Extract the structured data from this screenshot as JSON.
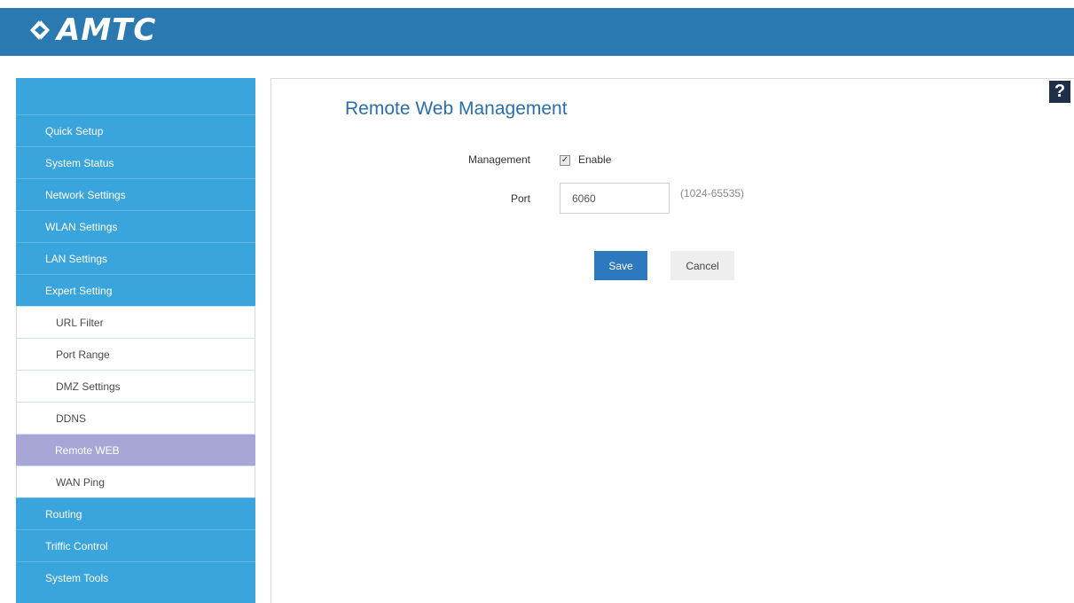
{
  "header": {
    "brand": "AMTC",
    "help_label": "?"
  },
  "sidebar": {
    "items": [
      {
        "label": "Quick Setup",
        "type": "main"
      },
      {
        "label": "System Status",
        "type": "main"
      },
      {
        "label": "Network Settings",
        "type": "main"
      },
      {
        "label": "WLAN Settings",
        "type": "main"
      },
      {
        "label": "LAN Settings",
        "type": "main"
      },
      {
        "label": "Expert Setting",
        "type": "main"
      },
      {
        "label": "URL Filter",
        "type": "sub"
      },
      {
        "label": "Port Range",
        "type": "sub"
      },
      {
        "label": "DMZ Settings",
        "type": "sub"
      },
      {
        "label": "DDNS",
        "type": "sub"
      },
      {
        "label": "Remote WEB",
        "type": "sub",
        "active": true
      },
      {
        "label": "WAN Ping",
        "type": "sub"
      },
      {
        "label": "Routing",
        "type": "main"
      },
      {
        "label": "Triffic Control",
        "type": "main"
      },
      {
        "label": "System Tools",
        "type": "main"
      }
    ]
  },
  "main": {
    "title": "Remote Web Management",
    "management_label": "Management",
    "enable_label": "Enable",
    "enable_checked": true,
    "port_label": "Port",
    "port_value": "6060",
    "port_range": "(1024-65535)",
    "save_label": "Save",
    "cancel_label": "Cancel"
  },
  "colors": {
    "header": "#2a7ab1",
    "sidebar": "#3aa4dc",
    "active_item": "#a8a6d6",
    "title": "#2a6fb0",
    "save_button": "#2e78bd"
  }
}
